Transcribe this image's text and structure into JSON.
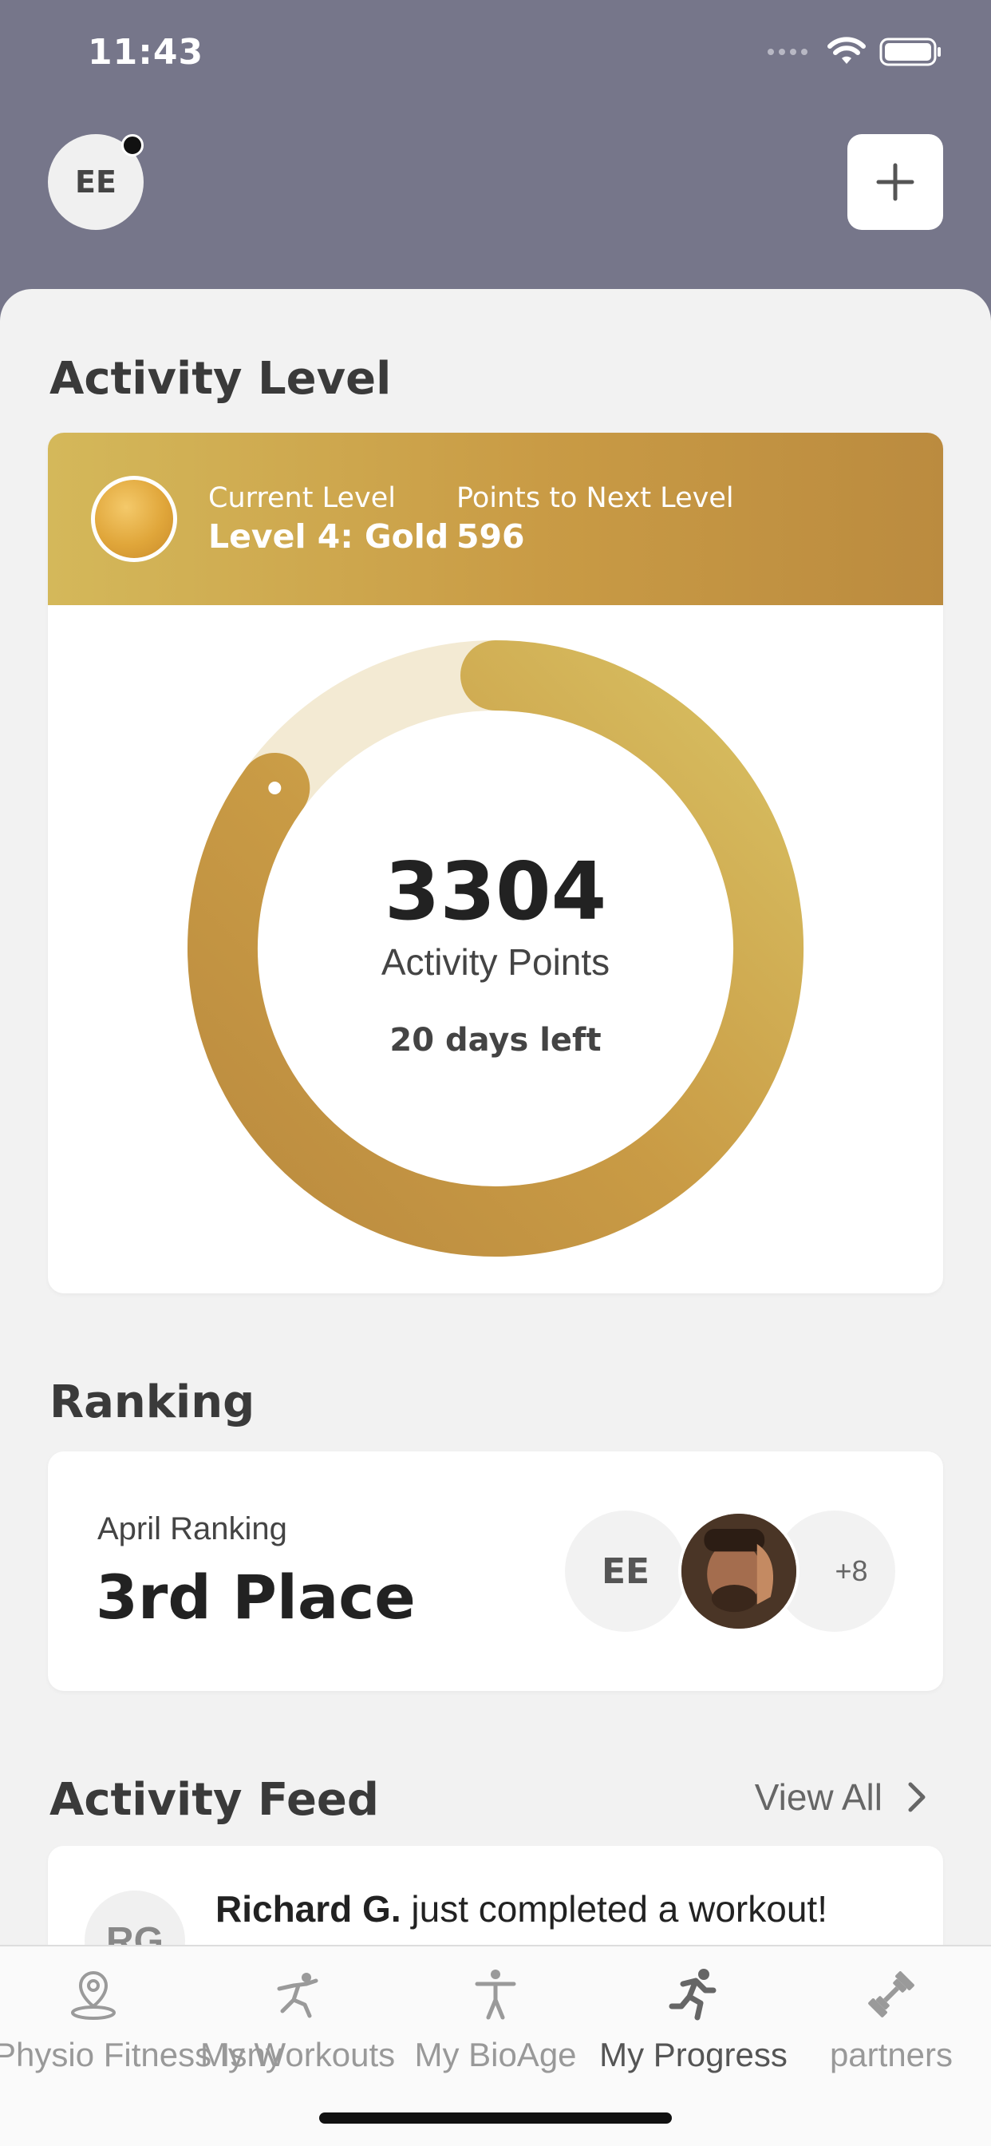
{
  "status_bar": {
    "time": "11:43"
  },
  "header": {
    "avatar_initials": "EE"
  },
  "activity_level": {
    "title": "Activity Level",
    "current_level_label": "Current Level",
    "current_level_value": "Level 4: Gold",
    "points_next_label": "Points to Next Level",
    "points_next_value": "596",
    "points": "3304",
    "points_label": "Activity Points",
    "days_left": "20 days left",
    "progress_fraction": 0.85
  },
  "ranking": {
    "title": "Ranking",
    "label": "April Ranking",
    "value": "3rd Place",
    "bubble_initials": "EE",
    "more_count": "+8"
  },
  "activity_feed": {
    "title": "Activity Feed",
    "view_all": "View All",
    "items": [
      {
        "initials": "RG",
        "name": "Richard G.",
        "text": "just completed a workout!"
      }
    ]
  },
  "tabbar": {
    "items": [
      {
        "label": "Physio Fitness Isny",
        "icon": "location-icon"
      },
      {
        "label": "My Workouts",
        "icon": "workout-icon"
      },
      {
        "label": "My BioAge",
        "icon": "person-icon"
      },
      {
        "label": "My Progress",
        "icon": "running-icon",
        "active": true
      },
      {
        "label": "partners",
        "icon": "dumbbell-icon"
      }
    ]
  },
  "colors": {
    "header_bg": "#76768a",
    "gold_light": "#d4b85a",
    "gold_dark": "#bb8b3f",
    "ring_track": "#f3ead3"
  }
}
